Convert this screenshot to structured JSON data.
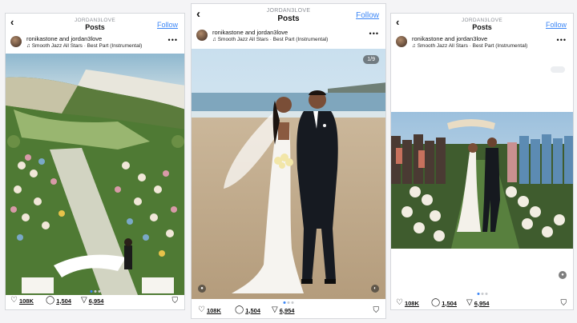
{
  "posts": [
    {
      "handle": "JORDAN3LOVE",
      "title": "Posts",
      "follow": "Follow",
      "users": "ronikastone and jordan3love",
      "audio": "Smooth Jazz All Stars · Best Part (Instrumental)",
      "likes": "108K",
      "comments": "1,504",
      "shares": "6,954"
    },
    {
      "handle": "JORDAN3LOVE",
      "title": "Posts",
      "follow": "Follow",
      "users": "ronikastone and jordan3love",
      "audio": "Smooth Jazz All Stars · Best Part (Instrumental)",
      "counter": "1/9",
      "likes": "108K",
      "comments": "1,504",
      "shares": "6,954"
    },
    {
      "handle": "JORDAN3LOVE",
      "title": "Posts",
      "follow": "Follow",
      "users": "ronikastone and jordan3love",
      "audio": "Smooth Jazz All Stars · Best Part (Instrumental)",
      "likes": "108K",
      "comments": "1,504",
      "shares": "6,954"
    }
  ],
  "icons": {
    "back": "chevron-left-icon",
    "more": "more-horizontal-icon",
    "music": "music-note-icon",
    "like": "heart-icon",
    "comment": "comment-icon",
    "share": "send-icon",
    "save": "bookmark-icon"
  },
  "colors": {
    "accent": "#3b86f6"
  }
}
